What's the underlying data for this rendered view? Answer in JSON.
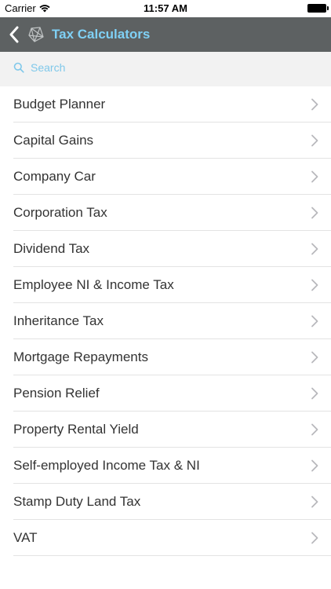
{
  "status_bar": {
    "carrier": "Carrier",
    "time": "11:57 AM"
  },
  "nav": {
    "title": "Tax Calculators",
    "title_color": "#7fd0f5",
    "bar_color": "#5d6162"
  },
  "search": {
    "placeholder": "Search"
  },
  "list": {
    "items": [
      {
        "label": "Budget Planner"
      },
      {
        "label": "Capital Gains"
      },
      {
        "label": "Company Car"
      },
      {
        "label": "Corporation Tax"
      },
      {
        "label": "Dividend Tax"
      },
      {
        "label": "Employee NI & Income Tax"
      },
      {
        "label": "Inheritance Tax"
      },
      {
        "label": "Mortgage Repayments"
      },
      {
        "label": "Pension Relief"
      },
      {
        "label": "Property Rental Yield"
      },
      {
        "label": "Self-employed Income Tax & NI"
      },
      {
        "label": "Stamp Duty Land Tax"
      },
      {
        "label": "VAT"
      }
    ]
  },
  "icons": {
    "back": "chevron-left-icon",
    "logo": "logo-icon",
    "search": "search-icon",
    "disclosure": "chevron-right-icon",
    "wifi": "wifi-icon",
    "battery": "battery-icon"
  }
}
